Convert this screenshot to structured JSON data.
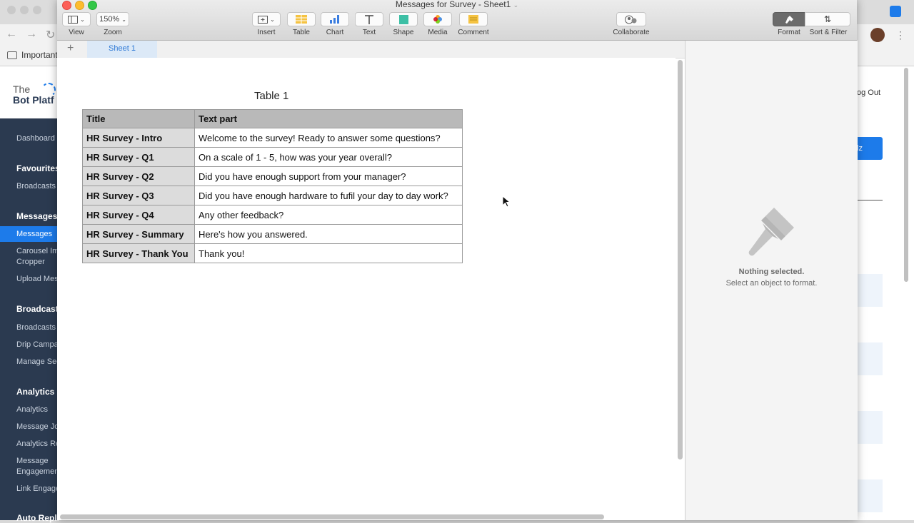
{
  "window": {
    "title": "Messages for Survey - Sheet1"
  },
  "toolbar": {
    "view_label": "View",
    "zoom_value": "150%",
    "zoom_label": "Zoom",
    "insert_label": "Insert",
    "table_label": "Table",
    "chart_label": "Chart",
    "text_label": "Text",
    "shape_label": "Shape",
    "media_label": "Media",
    "comment_label": "Comment",
    "collaborate_label": "Collaborate",
    "format_label": "Format",
    "sort_filter_label": "Sort & Filter"
  },
  "tabs": {
    "add": "+",
    "sheets": [
      "Sheet 1"
    ]
  },
  "table": {
    "title": "Table 1",
    "headers": [
      "Title",
      "Text part"
    ],
    "rows": [
      [
        "HR Survey - Intro",
        "Welcome to the survey! Ready to answer some questions?"
      ],
      [
        "HR Survey - Q1",
        "On a scale of 1 - 5, how was your year overall?"
      ],
      [
        "HR Survey - Q2",
        "Did you have enough support from your manager?"
      ],
      [
        "HR Survey - Q3",
        "Did you have enough hardware to fufil your day to day work?"
      ],
      [
        "HR Survey - Q4",
        "Any other feedback?"
      ],
      [
        "HR Survey - Summary",
        "Here's how you answered."
      ],
      [
        "HR Survey - Thank You",
        "Thank you!"
      ]
    ]
  },
  "inspector": {
    "title": "Nothing selected.",
    "subtitle": "Select an object to format."
  },
  "background_app": {
    "bookmark": "Important",
    "logo_line1": "The",
    "logo_line2": "Bot Platf",
    "logout": "og Out",
    "button_partial": "lz",
    "sidebar": [
      {
        "type": "item",
        "label": "Dashboard"
      },
      {
        "type": "head",
        "label": "Favourites"
      },
      {
        "type": "item",
        "label": "Broadcasts"
      },
      {
        "type": "head",
        "label": "Messages"
      },
      {
        "type": "active",
        "label": "Messages"
      },
      {
        "type": "item",
        "label": "Carousel Im"
      },
      {
        "type": "item",
        "label": "Cropper"
      },
      {
        "type": "item",
        "label": "Upload Mes"
      },
      {
        "type": "head",
        "label": "Broadcast"
      },
      {
        "type": "item",
        "label": "Broadcasts"
      },
      {
        "type": "item",
        "label": "Drip Campa"
      },
      {
        "type": "item",
        "label": "Manage Seg"
      },
      {
        "type": "head",
        "label": "Analytics"
      },
      {
        "type": "item",
        "label": "Analytics"
      },
      {
        "type": "item",
        "label": "Message Jo"
      },
      {
        "type": "item",
        "label": "Analytics Re"
      },
      {
        "type": "item",
        "label": "Message"
      },
      {
        "type": "item",
        "label": "Engagemen"
      },
      {
        "type": "item",
        "label": "Link Engage"
      },
      {
        "type": "head",
        "label": "Auto Repli"
      }
    ]
  },
  "colors": {
    "accent_blue": "#1d7bea",
    "sidebar_bg": "#2b3a50",
    "header_gray": "#b9b9b9"
  }
}
